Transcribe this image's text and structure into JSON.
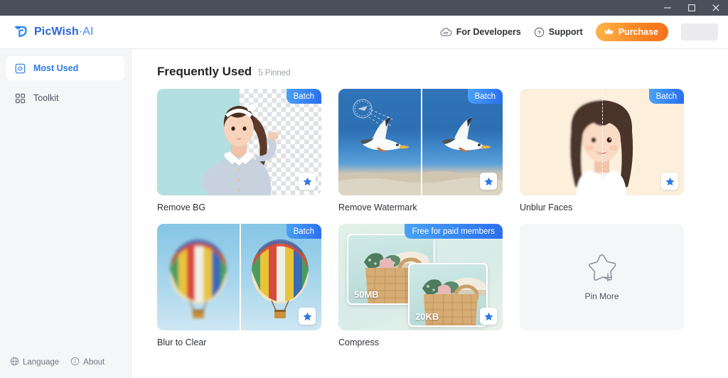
{
  "window": {
    "controls": [
      {
        "name": "minimize",
        "glyph": "minimize-icon"
      },
      {
        "name": "maximize",
        "glyph": "maximize-icon"
      },
      {
        "name": "close",
        "glyph": "close-icon"
      }
    ],
    "titlebar_color": "#4b4f5c"
  },
  "header": {
    "brand": {
      "name": "PicWish",
      "suffix": "·AI",
      "logo_icon": "picwish-bird-logo",
      "color": "#2a66d9"
    },
    "links": [
      {
        "label": "For Developers",
        "icon": "api-cloud-icon"
      },
      {
        "label": "Support",
        "icon": "question-circle-icon"
      }
    ],
    "purchase": {
      "label": "Purchase",
      "icon": "crown-icon",
      "color_start": "#ffb44a",
      "color_end": "#f4721c"
    },
    "account_chip": {
      "label": "",
      "icon": "account-avatar"
    }
  },
  "sidebar": {
    "items": [
      {
        "label": "Most Used",
        "icon": "most-used-icon",
        "active": true
      },
      {
        "label": "Toolkit",
        "icon": "toolkit-grid-icon",
        "active": false
      }
    ],
    "footer": [
      {
        "label": "Language",
        "icon": "globe-icon"
      },
      {
        "label": "About",
        "icon": "info-circle-icon"
      }
    ],
    "active_color": "#2a7ae4",
    "background": "#f5f6f8"
  },
  "main": {
    "section_title": "Frequently Used",
    "section_subtitle": "5 Pinned",
    "cards": [
      {
        "label": "Remove BG",
        "badge": "Batch",
        "pin_icon": "star-filled-icon",
        "thumb": "portrait-woman-teal-transparent-split"
      },
      {
        "label": "Remove Watermark",
        "badge": "Batch",
        "pin_icon": "star-filled-icon",
        "thumb": "seagull-over-sea-before-after-split"
      },
      {
        "label": "Unblur Faces",
        "badge": "Batch",
        "pin_icon": "star-filled-icon",
        "thumb": "child-portrait-cream-blur-split"
      },
      {
        "label": "Blur to Clear",
        "badge": "Batch",
        "pin_icon": "star-filled-icon",
        "thumb": "hot-air-balloon-before-after-split"
      },
      {
        "label": "Compress",
        "badge": "Free for paid members",
        "pin_icon": "star-filled-icon",
        "thumb": "basket-bag-compress-demo",
        "size_before": "50MB",
        "size_after": "20KB"
      }
    ],
    "pin_more": {
      "label": "Pin More",
      "icon": "star-plus-outline-icon"
    },
    "badge_color_start": "#4aa3f5",
    "badge_color_end": "#2a6ef0"
  }
}
